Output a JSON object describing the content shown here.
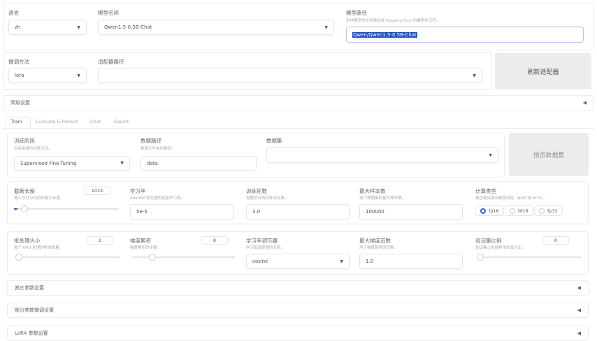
{
  "top": {
    "lang_label": "语言",
    "lang_value": "zh",
    "model_name_label": "模型名称",
    "model_name_value": "Qwen1.5-0.5B-Chat",
    "model_path_label": "模型路径",
    "model_path_info": "本地模型的文件路径或 Hugging Face 的模型标识符。",
    "model_path_value": "Qwen/Qwen1.5-0.5B-Chat",
    "finetune_label": "微调方法",
    "finetune_value": "lora",
    "adapter_label": "适配器路径",
    "adapter_value": "",
    "refresh_button": "刷新适配器",
    "advanced": "高级设置"
  },
  "tabs": [
    "Train",
    "Evaluate & Predict",
    "Chat",
    "Export"
  ],
  "train": {
    "stage_label": "训练阶段",
    "stage_info": "目前采用的训练方式。",
    "stage_value": "Supervised Fine-Tuning",
    "data_dir_label": "数据路径",
    "data_dir_info": "数据文件夹的路径。",
    "data_dir_value": "data",
    "dataset_label": "数据集",
    "preview_button": "预览数据集",
    "cutoff_label": "截断长度",
    "cutoff_info": "输入序列分词后的最大长度。",
    "cutoff_value": "1024",
    "cutoff_fraction": 0.03,
    "lr_label": "学习率",
    "lr_info": "AdamW 优化器的初始学习率。",
    "lr_value": "5e-5",
    "epochs_label": "训练轮数",
    "epochs_info": "需要执行的训练总轮数。",
    "epochs_value": "3.0",
    "max_samples_label": "最大样本数",
    "max_samples_info": "每个数据集的最大样本数。",
    "max_samples_value": "100000",
    "compute_label": "计算类型",
    "compute_info": "是否使用混合精度训练（fp16 或 bf16）。",
    "compute_options": [
      "fp16",
      "bf16",
      "fp32"
    ],
    "compute_selected": "fp16",
    "batch_label": "批处理大小",
    "batch_info": "每个 GPU 处理的样本数量。",
    "batch_value": "2",
    "grad_acc_label": "梯度累积",
    "grad_acc_info": "梯度累积的步数。",
    "grad_acc_value": "8",
    "sched_label": "学习率调节器",
    "sched_info": "学习率调度器的名称。",
    "sched_value": "cosine",
    "max_grad_label": "最大梯度范数",
    "max_grad_info": "用于梯度裁剪的范数。",
    "max_grad_value": "1.0",
    "val_label": "验证集比例",
    "val_info": "验证集占全部样本的百分比。",
    "val_value": "0"
  },
  "accordions": [
    "其它参数设置",
    "部分参数微调设置",
    "LoRA 参数设置"
  ]
}
